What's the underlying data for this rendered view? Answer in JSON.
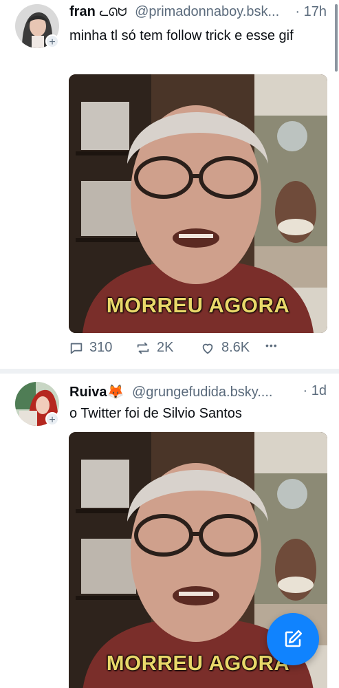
{
  "posts": [
    {
      "display_name": "fran",
      "name_emoji": "ᓚᘏᗢ",
      "handle": "@primadonnaboy.bsk...",
      "time": "· 17h",
      "text": "minha tl só tem follow trick e esse gif",
      "media_caption": "MORREU AGORA",
      "replies": "310",
      "reposts": "2K",
      "likes": "8.6K"
    },
    {
      "display_name": "Ruiva",
      "name_emoji": "🦊",
      "handle": "@grungefudida.bsky....",
      "time": "· 1d",
      "text": "o Twitter foi de Silvio Santos",
      "media_caption": "MORREU AGORA"
    }
  ],
  "avatar_badge": "+",
  "more_label": "•••",
  "colors": {
    "accent": "#1083fe",
    "muted": "#5b6b7c",
    "caption": "#e9d86a"
  },
  "icons": [
    "reply-icon",
    "repost-icon",
    "like-icon",
    "more-icon",
    "compose-icon"
  ]
}
